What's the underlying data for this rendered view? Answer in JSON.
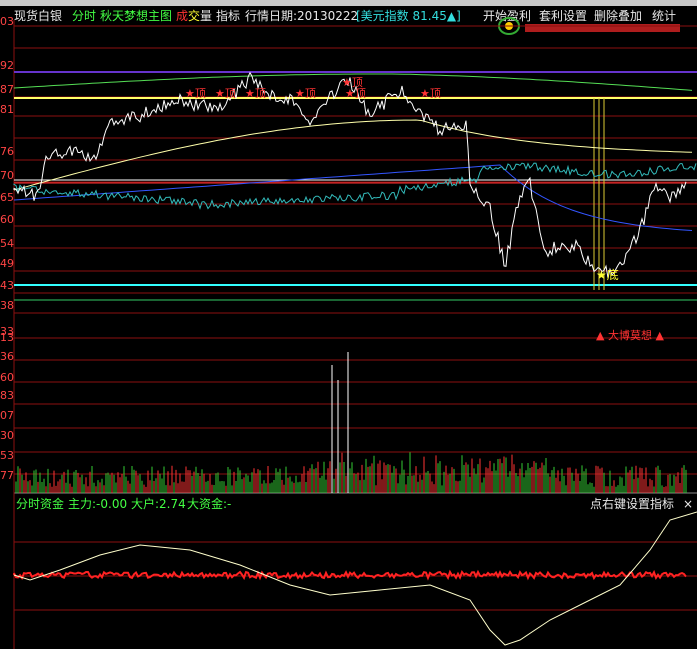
{
  "toolbar": {
    "product": "现货白银",
    "mode_tab": "分时",
    "template": "秋天梦想主图",
    "volume_label_1": "成",
    "volume_label_2": "交",
    "volume_label_3": "量",
    "indicator_tab": "指标",
    "quote_date": "行情日期:20130222",
    "usd_index": "[美元指数 81.45▲]",
    "start_profit": "开始盈利",
    "arbitrage_settings": "套利设置",
    "delete_overlay": "删除叠加",
    "stats": "统计"
  },
  "price_axis_ticks": [
    "03",
    "92",
    "87",
    "81",
    "76",
    "70",
    "65",
    "60",
    "54",
    "49",
    "43",
    "38",
    "33"
  ],
  "volume_axis_ticks": [
    "13",
    "36",
    "60",
    "83",
    "07",
    "30",
    "53",
    "77",
    "27"
  ],
  "markers": {
    "top_label": "顶",
    "top_count": 9,
    "bottom_label": "底",
    "bottom_label_partial": "底",
    "caption_partial": "大博莫想"
  },
  "indicator": {
    "title": "分时资金",
    "main_force": "主力:-0.00",
    "big_holder": "大户:2.74",
    "big_fund": "大资金:-",
    "right_hint": "点右键设置指标",
    "close_symbol": "×"
  },
  "colors": {
    "background": "#000000",
    "grid": "#8b1010",
    "price_line": "#ffffff",
    "avg_line": "#ffffaa",
    "ma_blue": "#3355ff",
    "index_line": "#33bbbb",
    "up_bar": "#ff3333",
    "down_bar": "#33cc33",
    "fund_line": "#ffffcc",
    "main_force_line": "#ff2222"
  }
}
